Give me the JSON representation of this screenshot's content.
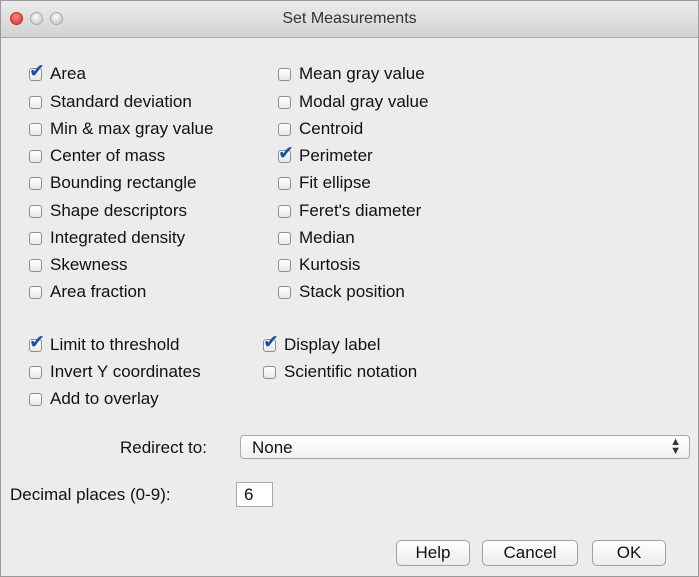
{
  "window": {
    "title": "Set Measurements"
  },
  "measurements": {
    "left": [
      {
        "label": "Area",
        "checked": true
      },
      {
        "label": "Standard deviation",
        "checked": false
      },
      {
        "label": "Min & max gray value",
        "checked": false
      },
      {
        "label": "Center of mass",
        "checked": false
      },
      {
        "label": "Bounding rectangle",
        "checked": false
      },
      {
        "label": "Shape descriptors",
        "checked": false
      },
      {
        "label": "Integrated density",
        "checked": false
      },
      {
        "label": "Skewness",
        "checked": false
      },
      {
        "label": "Area fraction",
        "checked": false
      }
    ],
    "right": [
      {
        "label": "Mean gray value",
        "checked": false
      },
      {
        "label": "Modal gray value",
        "checked": false
      },
      {
        "label": "Centroid",
        "checked": false
      },
      {
        "label": "Perimeter",
        "checked": true
      },
      {
        "label": "Fit ellipse",
        "checked": false
      },
      {
        "label": "Feret's diameter",
        "checked": false
      },
      {
        "label": "Median",
        "checked": false
      },
      {
        "label": "Kurtosis",
        "checked": false
      },
      {
        "label": "Stack position",
        "checked": false
      }
    ]
  },
  "options": {
    "left": [
      {
        "label": "Limit to threshold",
        "checked": true
      },
      {
        "label": "Invert Y coordinates",
        "checked": false
      },
      {
        "label": "Add to overlay",
        "checked": false
      }
    ],
    "right": [
      {
        "label": "Display label",
        "checked": true
      },
      {
        "label": "Scientific notation",
        "checked": false
      }
    ]
  },
  "redirect": {
    "label": "Redirect to:",
    "value": "None"
  },
  "decimal": {
    "label": "Decimal places (0-9):",
    "value": "6"
  },
  "buttons": {
    "help": "Help",
    "cancel": "Cancel",
    "ok": "OK"
  },
  "icons": {
    "checkmark": "✔",
    "select_arrows": "⬍"
  }
}
